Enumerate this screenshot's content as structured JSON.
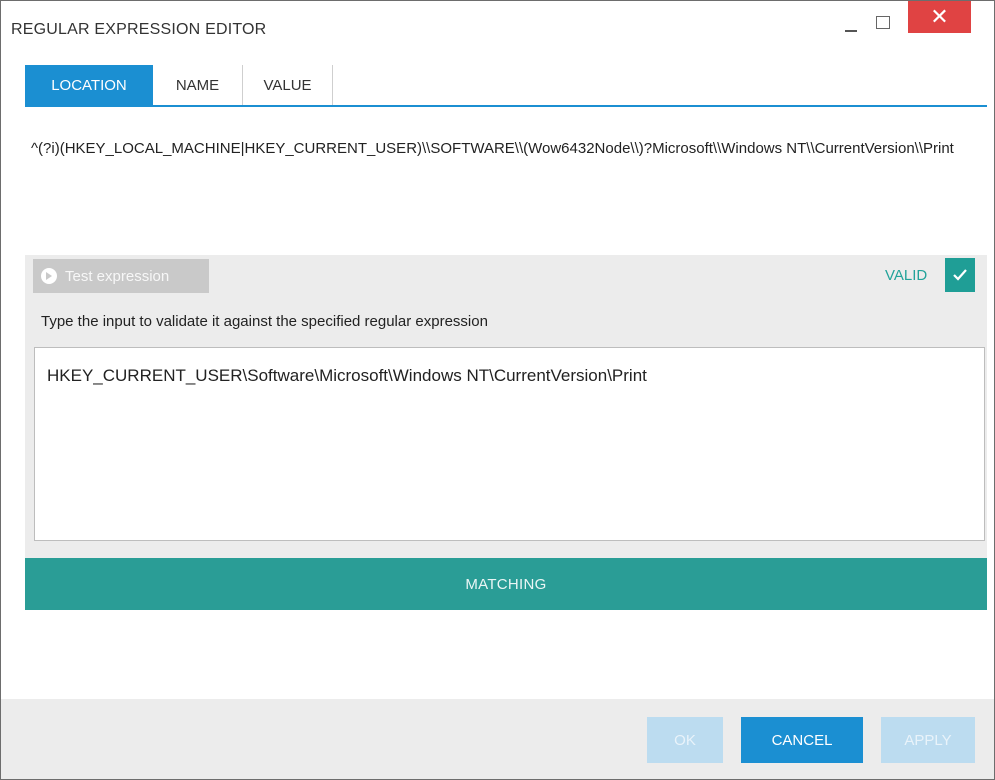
{
  "window": {
    "title": "REGULAR EXPRESSION EDITOR",
    "close_glyph": "✕"
  },
  "tabs": [
    {
      "label": "LOCATION",
      "active": true
    },
    {
      "label": "NAME",
      "active": false
    },
    {
      "label": "VALUE",
      "active": false
    }
  ],
  "regex": {
    "value": "^(?i)(HKEY_LOCAL_MACHINE|HKEY_CURRENT_USER)\\\\SOFTWARE\\\\(Wow6432Node\\\\)?Microsoft\\\\Windows NT\\\\CurrentVersion\\\\Print"
  },
  "test": {
    "button_label": "Test expression",
    "status_label": "VALID",
    "hint": "Type the input to validate it against the specified regular expression",
    "input_value": "HKEY_CURRENT_USER\\Software\\Microsoft\\Windows NT\\CurrentVersion\\Print",
    "result_label": "MATCHING"
  },
  "footer": {
    "ok_label": "OK",
    "cancel_label": "CANCEL",
    "apply_label": "APPLY"
  },
  "colors": {
    "accent": "#1b8fd2",
    "teal": "#2a9d96",
    "close_red": "#e04343"
  },
  "icons": [
    "minimize-icon",
    "maximize-icon",
    "close-icon",
    "play-icon",
    "checkmark-icon"
  ]
}
